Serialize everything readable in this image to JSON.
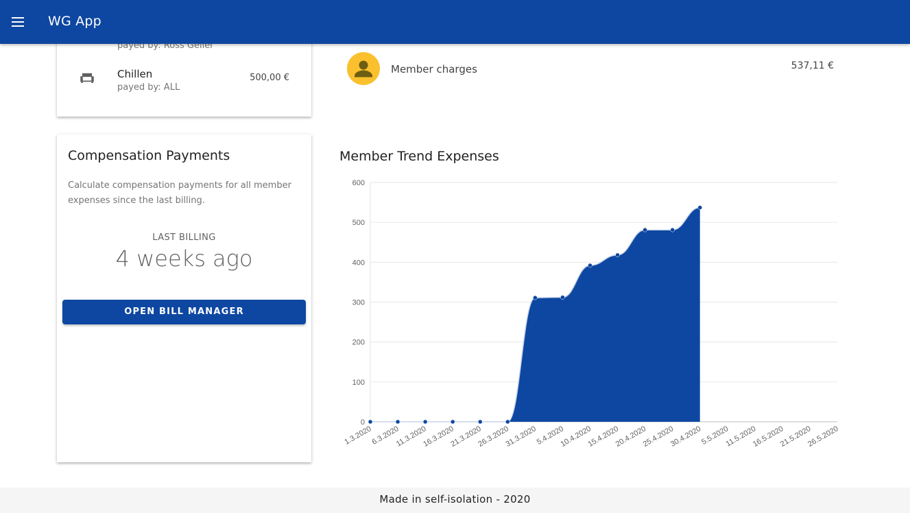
{
  "appbar": {
    "title": "WG App",
    "menu_icon": "menu-icon"
  },
  "expenses_card": {
    "items": [
      {
        "name": "",
        "payed_by": "payed by: Ross Geller",
        "amount": ""
      },
      {
        "name": "Chillen",
        "payed_by": "payed by: ALL",
        "amount": "500,00 €",
        "icon": "sofa-icon"
      }
    ]
  },
  "compensation": {
    "title": "Compensation Payments",
    "description": "Calculate compensation payments for all member expenses since the last billing.",
    "last_billing_label": "LAST BILLING",
    "last_billing_value": "4 weeks ago",
    "button_label": "OPEN BILL MANAGER"
  },
  "member_charges": {
    "label": "Member charges",
    "amount": "537,11 €",
    "icon": "person-icon",
    "avatar_color": "#fbc02d"
  },
  "chart_data": {
    "type": "area",
    "title": "Member Trend Expenses",
    "xlabel": "",
    "ylabel": "",
    "ylim": [
      0,
      600
    ],
    "yticks": [
      0,
      100,
      200,
      300,
      400,
      500,
      600
    ],
    "categories": [
      "1.3.2020",
      "6.3.2020",
      "11.3.2020",
      "16.3.2020",
      "21.3.2020",
      "26.3.2020",
      "31.3.2020",
      "5.4.2020",
      "10.4.2020",
      "15.4.2020",
      "20.4.2020",
      "25.4.2020",
      "30.4.2020",
      "5.5.2020",
      "11.5.2020",
      "16.5.2020",
      "21.5.2020",
      "26.5.2020"
    ],
    "values": [
      0,
      0,
      0,
      0,
      0,
      0,
      311,
      312,
      392,
      418,
      481,
      481,
      537,
      null,
      null,
      null,
      null,
      null
    ],
    "grid": true,
    "legend": "none",
    "color": "#0d47a1"
  },
  "footer": {
    "text": "Made in self-isolation - 2020"
  },
  "colors": {
    "primary": "#0d47a1",
    "footer_bg": "#f5f5f5"
  }
}
